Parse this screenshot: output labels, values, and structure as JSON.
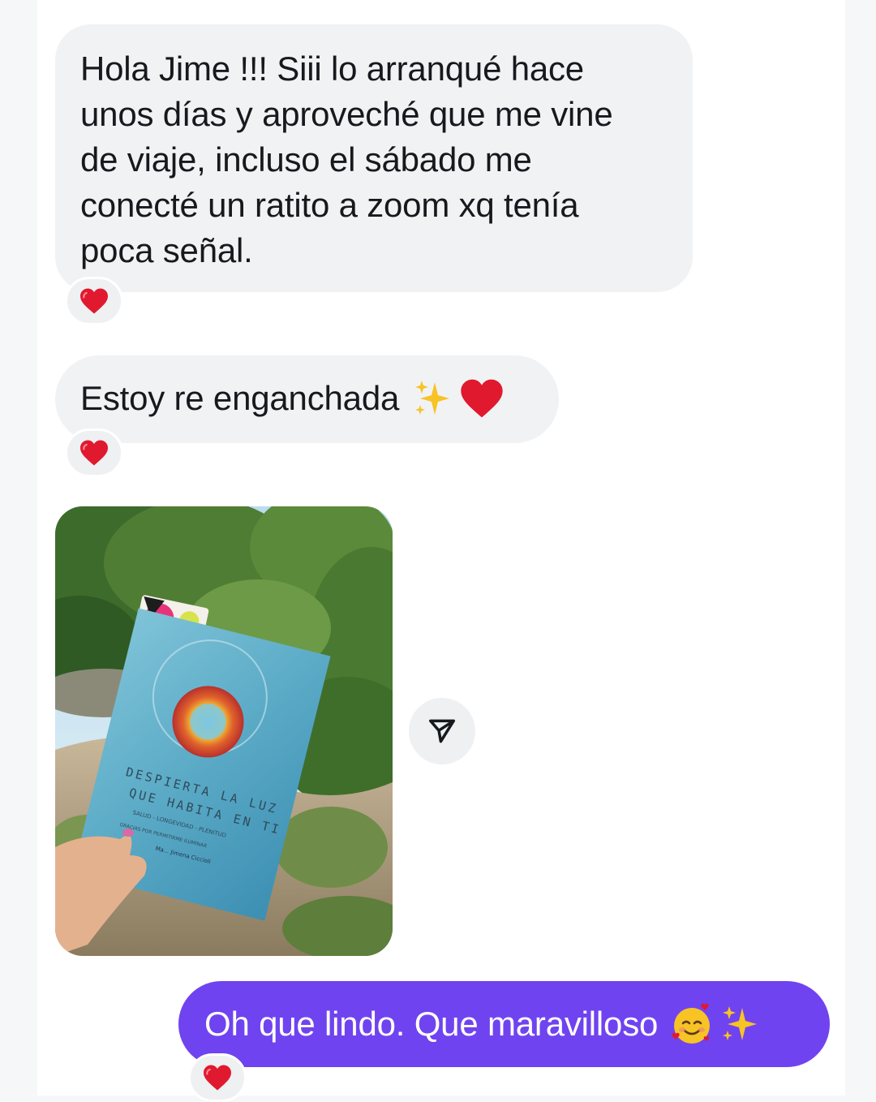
{
  "messages": [
    {
      "direction": "incoming",
      "lines": [
        "Hola Jime !!! Siii lo arranqué hace",
        "unos días y aproveché que me vine",
        "de viaje, incluso el sábado me",
        "conecté un ratito a zoom xq tenía",
        "poca señal."
      ],
      "reaction": "heart-icon"
    },
    {
      "direction": "incoming",
      "text": "Estoy re enganchada",
      "emojis": [
        "sparkles-icon",
        "red-heart-icon"
      ],
      "reaction": "heart-icon"
    },
    {
      "direction": "incoming",
      "type": "photo",
      "photo": {
        "book_title_line1": "DESPIERTA LA LUZ",
        "book_title_line2": "QUE HABITA EN TI",
        "book_subtitle": "SALUD - LONGEVIDAD - PLENITUD",
        "book_tagline": "GRACIAS POR PERMITIRME ILUMINAR",
        "book_author": "Ma... Jimena Ciccioli"
      },
      "share_icon": "share-arrow-icon"
    },
    {
      "direction": "outgoing",
      "text": "Oh que lindo. Que maravilloso",
      "emojis": [
        "smiling-face-with-hearts-icon",
        "sparkles-icon"
      ],
      "reaction": "heart-icon"
    }
  ],
  "colors": {
    "incoming_bubble": "#f1f2f4",
    "outgoing_bubble": "#7043f0",
    "heart": "#e0192f"
  }
}
